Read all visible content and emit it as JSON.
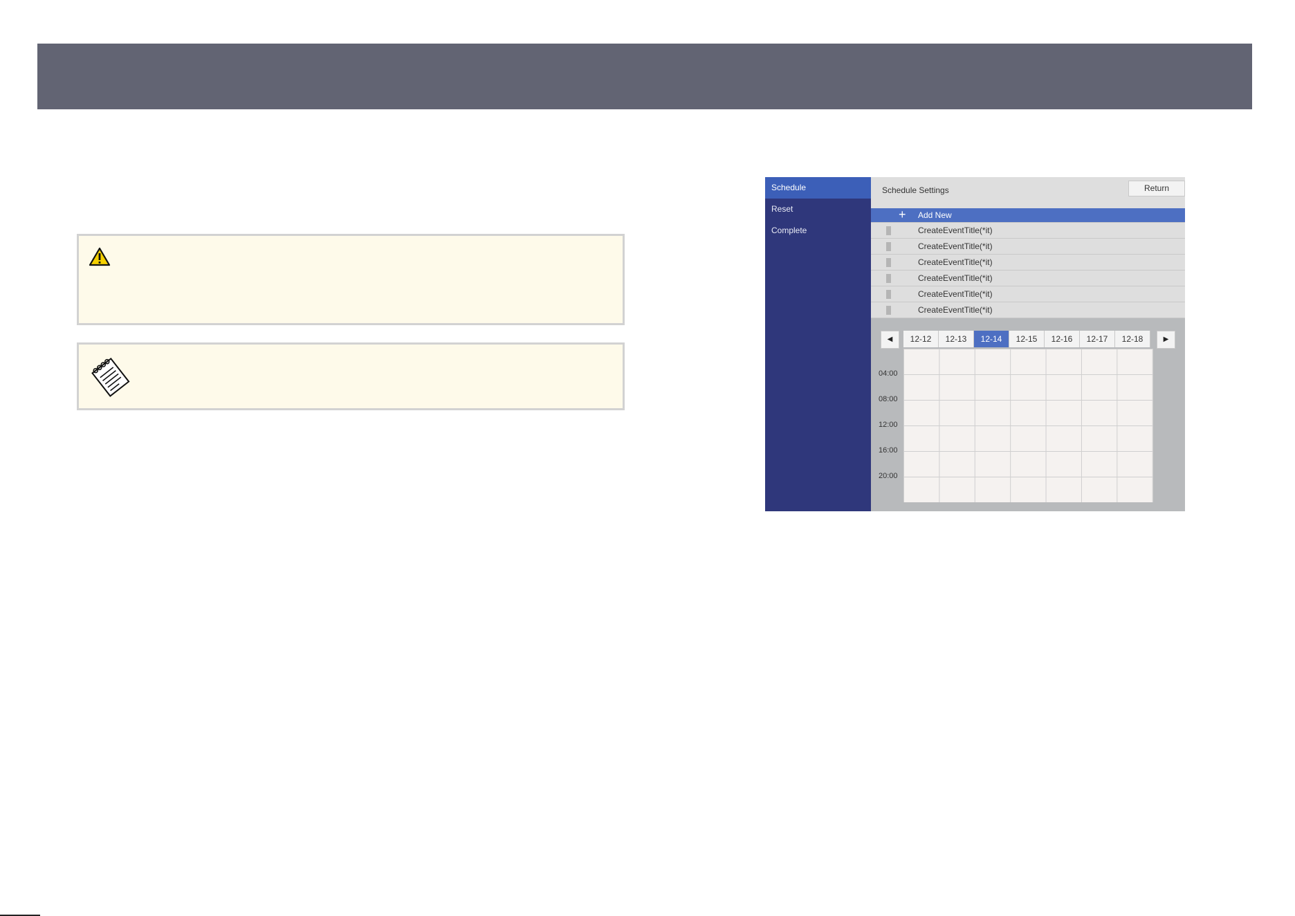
{
  "icons": {
    "warning": "warning-triangle-icon",
    "note": "notepad-icon"
  },
  "panel": {
    "sidebar": {
      "items": [
        {
          "label": "Schedule",
          "active": true
        },
        {
          "label": "Reset",
          "active": false
        },
        {
          "label": "Complete",
          "active": false
        }
      ]
    },
    "header": {
      "title": "Schedule Settings",
      "return_label": "Return"
    },
    "events": {
      "add_label": "Add New",
      "items": [
        "CreateEventTitle(*it)",
        "CreateEventTitle(*it)",
        "CreateEventTitle(*it)",
        "CreateEventTitle(*it)",
        "CreateEventTitle(*it)",
        "CreateEventTitle(*it)"
      ]
    },
    "calendar": {
      "prev": "◀",
      "next": "▶",
      "dates": [
        "12-12",
        "12-13",
        "12-14",
        "12-15",
        "12-16",
        "12-17",
        "12-18"
      ],
      "selected_date": "12-14",
      "times": [
        "04:00",
        "08:00",
        "12:00",
        "16:00",
        "20:00"
      ]
    }
  },
  "colors": {
    "header_bar": "#626473",
    "sidebar": "#2f377b",
    "accent": "#4d6fc2",
    "callout_bg": "#fefaea"
  }
}
